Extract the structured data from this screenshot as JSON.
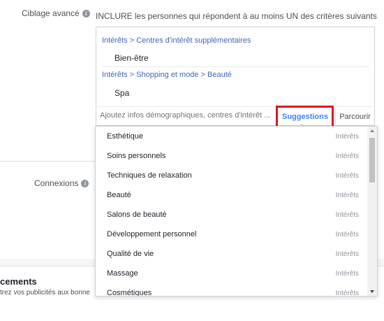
{
  "ciblage": {
    "label": "Ciblage avancé",
    "include_header": "INCLURE les personnes qui répondent à au moins UN des critères suivants"
  },
  "criteria": [
    {
      "path": "Intérêts > Centres d'intérêt supplémentaires",
      "item": "Bien-être"
    },
    {
      "path": "Intérêts > Shopping et mode > Beauté",
      "item": "Spa"
    }
  ],
  "search": {
    "placeholder": "Ajoutez infos démographiques, centres d'intérêt ...",
    "suggestions_label": "Suggestions",
    "browse_label": "Parcourir"
  },
  "dropdown": [
    {
      "label": "Esthétique",
      "type": "Intérêts"
    },
    {
      "label": "Soins personnels",
      "type": "Intérêts"
    },
    {
      "label": "Techniques de relaxation",
      "type": "Intérêts"
    },
    {
      "label": "Beauté",
      "type": "Intérêts"
    },
    {
      "label": "Salons de beauté",
      "type": "Intérêts"
    },
    {
      "label": "Développement personnel",
      "type": "Intérêts"
    },
    {
      "label": "Qualité de vie",
      "type": "Intérêts"
    },
    {
      "label": "Massage",
      "type": "Intérêts"
    },
    {
      "label": "Cosmétiques",
      "type": "Intérêts"
    }
  ],
  "connexions": {
    "label": "Connexions"
  },
  "placements": {
    "title": "cements",
    "desc": "trez vos publicités aux bonne"
  },
  "colors": {
    "link": "#4267b2",
    "suggestions_accent": "#4080ff",
    "highlight_box": "#e1131f"
  },
  "icons": {
    "info": "info-icon"
  }
}
